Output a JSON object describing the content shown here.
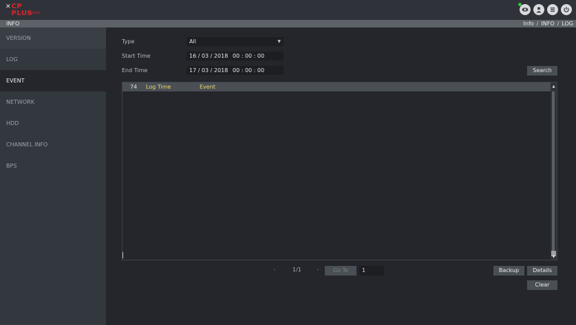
{
  "header": {
    "logo_mark": "✕",
    "logo_text": "CP PLUS",
    "logo_sub": "Trusted",
    "icons": [
      "live-view-icon",
      "user-icon",
      "menu-icon",
      "power-icon"
    ],
    "status_color": "#38c23c"
  },
  "titlebar": {
    "title": "INFO",
    "breadcrumb": [
      "Info",
      "INFO",
      "LOG"
    ],
    "separator": "/"
  },
  "sidebar": {
    "items": [
      {
        "label": "VERSION",
        "active": false
      },
      {
        "label": "LOG",
        "active": false
      },
      {
        "label": "EVENT",
        "active": true
      },
      {
        "label": "NETWORK",
        "active": false
      },
      {
        "label": "HDD",
        "active": false
      },
      {
        "label": "CHANNEL INFO",
        "active": false
      },
      {
        "label": "BPS",
        "active": false
      }
    ]
  },
  "filters": {
    "type_label": "Type",
    "type_value": "All",
    "start_label": "Start Time",
    "start_date": "16 / 03 / 2018",
    "start_time": "00 : 00 : 00",
    "end_label": "End Time",
    "end_date": "17 / 03 / 2018",
    "end_time": "00 : 00 : 00",
    "search_label": "Search"
  },
  "table": {
    "count": "74",
    "columns": [
      "Log Time",
      "Event"
    ],
    "rows": []
  },
  "pager": {
    "prev": "‹",
    "info": "1/1",
    "next": "›",
    "goto_label": "Go To",
    "page_value": "1"
  },
  "actions": {
    "backup_label": "Backup",
    "details_label": "Details",
    "clear_label": "Clear"
  }
}
